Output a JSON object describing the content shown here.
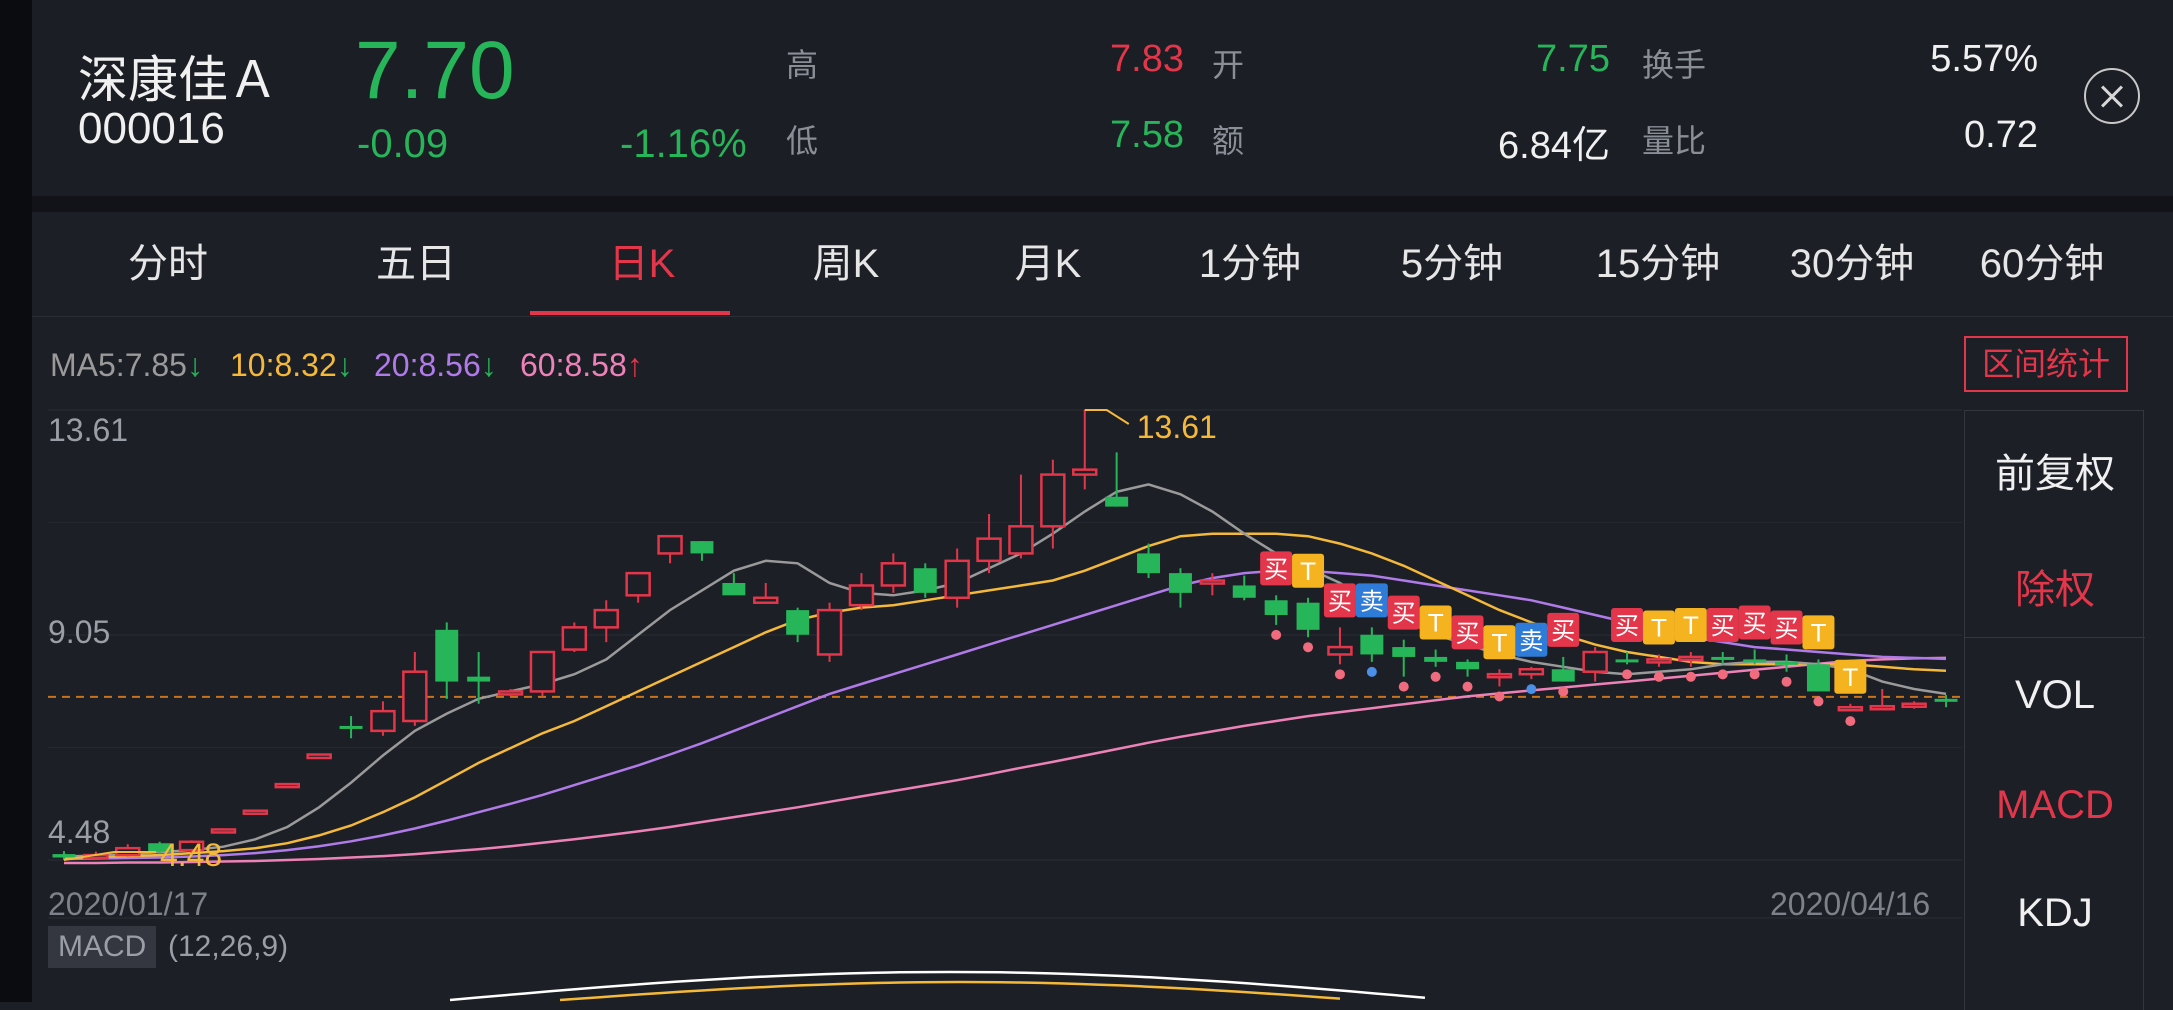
{
  "stock": {
    "name": "深康佳Ａ",
    "code": "000016",
    "price": "7.70",
    "change": "-0.09",
    "change_pct": "-1.16%"
  },
  "quote": {
    "high_label": "高",
    "high": "7.83",
    "open_label": "开",
    "open": "7.75",
    "turnover_label": "换手",
    "turnover": "5.57%",
    "low_label": "低",
    "low": "7.58",
    "amount_label": "额",
    "amount": "6.84亿",
    "vol_ratio_label": "量比",
    "vol_ratio": "0.72"
  },
  "tabs": [
    "分时",
    "五日",
    "日K",
    "周K",
    "月K",
    "1分钟",
    "5分钟",
    "15分钟",
    "30分钟",
    "60分钟"
  ],
  "active_tab": "日K",
  "ma": {
    "ma5": "MA5:7.85",
    "ma5_arrow": "↓",
    "ma10": "10:8.32",
    "ma10_arrow": "↓",
    "ma20": "20:8.56",
    "ma20_arrow": "↓",
    "ma60": "60:8.58",
    "ma60_arrow": "↑"
  },
  "range_stats_label": "区间统计",
  "side_panel": {
    "fq_before": "前复权",
    "fq_none": "除权",
    "vol": "VOL",
    "macd": "MACD",
    "kdj": "KDJ"
  },
  "macd_panel": {
    "tag": "MACD",
    "params": "(12,26,9)"
  },
  "colors": {
    "up": "#e3364a",
    "down": "#27b55a",
    "ma5": "#9a9a9a",
    "ma10": "#f5b93a",
    "ma20": "#b07be8",
    "ma60": "#ee82b8",
    "accent": "#e3364a"
  },
  "chart_data": {
    "type": "candlestick",
    "y_axis_labels": [
      "13.61",
      "9.05",
      "4.48"
    ],
    "ylim": [
      4.48,
      13.61
    ],
    "x_start": "2020/01/17",
    "x_end": "2020/04/16",
    "max_label": "13.61",
    "min_label": "4.48",
    "reference_price": 7.79,
    "candles": [
      {
        "o": 4.6,
        "h": 4.66,
        "l": 4.48,
        "c": 4.53
      },
      {
        "o": 4.55,
        "h": 4.65,
        "l": 4.5,
        "c": 4.58
      },
      {
        "o": 4.58,
        "h": 4.8,
        "l": 4.55,
        "c": 4.72
      },
      {
        "o": 4.82,
        "h": 4.85,
        "l": 4.6,
        "c": 4.65
      },
      {
        "o": 4.68,
        "h": 4.88,
        "l": 4.62,
        "c": 4.85
      },
      {
        "o": 5.05,
        "h": 5.12,
        "l": 5.02,
        "c": 5.1
      },
      {
        "o": 5.42,
        "h": 5.5,
        "l": 5.4,
        "c": 5.48
      },
      {
        "o": 5.96,
        "h": 6.03,
        "l": 5.94,
        "c": 6.02
      },
      {
        "o": 6.55,
        "h": 6.63,
        "l": 6.53,
        "c": 6.62
      },
      {
        "o": 7.2,
        "h": 7.4,
        "l": 6.95,
        "c": 7.15
      },
      {
        "o": 7.1,
        "h": 7.7,
        "l": 7.0,
        "c": 7.5
      },
      {
        "o": 7.3,
        "h": 8.7,
        "l": 7.2,
        "c": 8.3
      },
      {
        "o": 9.15,
        "h": 9.3,
        "l": 7.75,
        "c": 8.1
      },
      {
        "o": 8.2,
        "h": 8.7,
        "l": 7.65,
        "c": 8.1
      },
      {
        "o": 7.85,
        "h": 7.95,
        "l": 7.8,
        "c": 7.9
      },
      {
        "o": 7.9,
        "h": 8.7,
        "l": 7.8,
        "c": 8.7
      },
      {
        "o": 8.75,
        "h": 9.3,
        "l": 8.7,
        "c": 9.2
      },
      {
        "o": 9.2,
        "h": 9.75,
        "l": 8.9,
        "c": 9.55
      },
      {
        "o": 9.85,
        "h": 10.3,
        "l": 9.7,
        "c": 10.3
      },
      {
        "o": 10.7,
        "h": 11.05,
        "l": 10.5,
        "c": 11.05
      },
      {
        "o": 10.95,
        "h": 10.95,
        "l": 10.55,
        "c": 10.7
      },
      {
        "o": 10.1,
        "h": 10.3,
        "l": 9.9,
        "c": 9.85
      },
      {
        "o": 9.7,
        "h": 10.1,
        "l": 9.7,
        "c": 9.8
      },
      {
        "o": 9.55,
        "h": 9.6,
        "l": 8.9,
        "c": 9.05
      },
      {
        "o": 8.65,
        "h": 9.7,
        "l": 8.5,
        "c": 9.55
      },
      {
        "o": 9.65,
        "h": 10.3,
        "l": 9.55,
        "c": 10.05
      },
      {
        "o": 10.05,
        "h": 10.7,
        "l": 9.9,
        "c": 10.5
      },
      {
        "o": 10.4,
        "h": 10.5,
        "l": 9.8,
        "c": 9.9
      },
      {
        "o": 9.8,
        "h": 10.8,
        "l": 9.6,
        "c": 10.55
      },
      {
        "o": 10.55,
        "h": 11.5,
        "l": 10.3,
        "c": 11.0
      },
      {
        "o": 10.7,
        "h": 12.3,
        "l": 10.6,
        "c": 11.25
      },
      {
        "o": 11.25,
        "h": 12.6,
        "l": 10.8,
        "c": 12.3
      },
      {
        "o": 12.3,
        "h": 13.61,
        "l": 12.0,
        "c": 12.4
      },
      {
        "o": 11.85,
        "h": 12.75,
        "l": 11.65,
        "c": 11.65
      },
      {
        "o": 10.7,
        "h": 10.9,
        "l": 10.2,
        "c": 10.3
      },
      {
        "o": 10.3,
        "h": 10.4,
        "l": 9.6,
        "c": 9.9
      },
      {
        "o": 10.1,
        "h": 10.3,
        "l": 9.85,
        "c": 10.15
      },
      {
        "o": 10.05,
        "h": 10.25,
        "l": 9.75,
        "c": 9.8
      },
      {
        "o": 9.75,
        "h": 9.85,
        "l": 9.25,
        "c": 9.45
      },
      {
        "o": 9.7,
        "h": 9.8,
        "l": 9.0,
        "c": 9.15
      },
      {
        "o": 8.65,
        "h": 9.2,
        "l": 8.45,
        "c": 8.8
      },
      {
        "o": 9.05,
        "h": 9.2,
        "l": 8.5,
        "c": 8.65
      },
      {
        "o": 8.8,
        "h": 8.95,
        "l": 8.2,
        "c": 8.6
      },
      {
        "o": 8.6,
        "h": 8.75,
        "l": 8.4,
        "c": 8.5
      },
      {
        "o": 8.5,
        "h": 8.55,
        "l": 8.2,
        "c": 8.35
      },
      {
        "o": 8.25,
        "h": 8.35,
        "l": 8.0,
        "c": 8.25
      },
      {
        "o": 8.25,
        "h": 8.4,
        "l": 8.15,
        "c": 8.35
      },
      {
        "o": 8.35,
        "h": 8.6,
        "l": 8.1,
        "c": 8.1
      },
      {
        "o": 8.3,
        "h": 8.8,
        "l": 8.1,
        "c": 8.7
      },
      {
        "o": 8.55,
        "h": 8.7,
        "l": 8.45,
        "c": 8.5
      },
      {
        "o": 8.55,
        "h": 8.65,
        "l": 8.4,
        "c": 8.55
      },
      {
        "o": 8.55,
        "h": 8.7,
        "l": 8.4,
        "c": 8.6
      },
      {
        "o": 8.6,
        "h": 8.7,
        "l": 8.45,
        "c": 8.55
      },
      {
        "o": 8.55,
        "h": 8.75,
        "l": 8.45,
        "c": 8.5
      },
      {
        "o": 8.5,
        "h": 8.65,
        "l": 8.3,
        "c": 8.45
      },
      {
        "o": 8.45,
        "h": 8.55,
        "l": 7.9,
        "c": 7.9
      },
      {
        "o": 7.55,
        "h": 7.65,
        "l": 7.5,
        "c": 7.58
      },
      {
        "o": 7.6,
        "h": 7.95,
        "l": 7.55,
        "c": 7.6
      },
      {
        "o": 7.6,
        "h": 7.7,
        "l": 7.55,
        "c": 7.65
      },
      {
        "o": 7.75,
        "h": 7.83,
        "l": 7.58,
        "c": 7.7
      }
    ],
    "ma5": [
      4.55,
      4.57,
      4.6,
      4.64,
      4.68,
      4.75,
      4.9,
      5.15,
      5.55,
      6.05,
      6.6,
      7.1,
      7.45,
      7.75,
      7.9,
      8.05,
      8.25,
      8.55,
      9.05,
      9.55,
      9.95,
      10.35,
      10.55,
      10.5,
      10.1,
      9.9,
      9.85,
      9.95,
      10.1,
      10.4,
      10.7,
      11.1,
      11.55,
      11.95,
      12.1,
      11.9,
      11.55,
      11.1,
      10.7,
      10.4,
      10.1,
      9.7,
      9.35,
      9.05,
      8.85,
      8.65,
      8.5,
      8.4,
      8.3,
      8.25,
      8.3,
      8.35,
      8.45,
      8.5,
      8.5,
      8.45,
      8.35,
      8.1,
      7.95,
      7.85
    ],
    "ma10": [
      4.52,
      4.54,
      4.56,
      4.58,
      4.62,
      4.66,
      4.72,
      4.82,
      4.98,
      5.18,
      5.45,
      5.75,
      6.1,
      6.45,
      6.75,
      7.05,
      7.3,
      7.6,
      7.9,
      8.2,
      8.5,
      8.8,
      9.1,
      9.35,
      9.5,
      9.6,
      9.65,
      9.75,
      9.85,
      9.95,
      10.05,
      10.15,
      10.35,
      10.6,
      10.85,
      11.05,
      11.1,
      11.1,
      11.1,
      11.05,
      10.9,
      10.7,
      10.45,
      10.15,
      9.85,
      9.55,
      9.3,
      9.05,
      8.85,
      8.7,
      8.6,
      8.5,
      8.45,
      8.45,
      8.45,
      8.45,
      8.45,
      8.4,
      8.35,
      8.32
    ],
    "ma20": [
      4.5,
      4.51,
      4.52,
      4.53,
      4.55,
      4.58,
      4.62,
      4.68,
      4.76,
      4.86,
      4.98,
      5.12,
      5.28,
      5.45,
      5.62,
      5.8,
      6.0,
      6.2,
      6.4,
      6.62,
      6.85,
      7.1,
      7.35,
      7.6,
      7.85,
      8.05,
      8.25,
      8.45,
      8.65,
      8.85,
      9.05,
      9.25,
      9.45,
      9.65,
      9.85,
      10.05,
      10.2,
      10.3,
      10.35,
      10.35,
      10.3,
      10.25,
      10.15,
      10.05,
      9.95,
      9.85,
      9.75,
      9.6,
      9.45,
      9.3,
      9.15,
      9.0,
      8.9,
      8.8,
      8.75,
      8.7,
      8.65,
      8.6,
      8.58,
      8.56
    ],
    "ma60": [
      4.42,
      4.42,
      4.43,
      4.43,
      4.44,
      4.45,
      4.46,
      4.48,
      4.5,
      4.53,
      4.56,
      4.6,
      4.65,
      4.7,
      4.76,
      4.83,
      4.9,
      4.98,
      5.06,
      5.15,
      5.25,
      5.35,
      5.45,
      5.55,
      5.66,
      5.77,
      5.88,
      5.99,
      6.1,
      6.22,
      6.35,
      6.47,
      6.6,
      6.73,
      6.86,
      6.98,
      7.09,
      7.2,
      7.3,
      7.4,
      7.48,
      7.56,
      7.64,
      7.72,
      7.8,
      7.86,
      7.92,
      7.98,
      8.04,
      8.1,
      8.16,
      8.22,
      8.28,
      8.34,
      8.4,
      8.46,
      8.52,
      8.55,
      8.57,
      8.58
    ],
    "signals": [
      {
        "i": 38,
        "label": "买",
        "kind": "buy",
        "side": "above"
      },
      {
        "i": 39,
        "label": "T",
        "kind": "t",
        "side": "above"
      },
      {
        "i": 40,
        "label": "买",
        "kind": "buy",
        "side": "above"
      },
      {
        "i": 41,
        "label": "卖",
        "kind": "sell",
        "side": "above"
      },
      {
        "i": 42,
        "label": "买",
        "kind": "buy",
        "side": "above"
      },
      {
        "i": 43,
        "label": "T",
        "kind": "t",
        "side": "above"
      },
      {
        "i": 44,
        "label": "买",
        "kind": "buy",
        "side": "above"
      },
      {
        "i": 45,
        "label": "T",
        "kind": "t",
        "side": "above"
      },
      {
        "i": 46,
        "label": "卖",
        "kind": "sell",
        "side": "above"
      },
      {
        "i": 47,
        "label": "买",
        "kind": "buy",
        "side": "above"
      },
      {
        "i": 49,
        "label": "买",
        "kind": "buy",
        "side": "above"
      },
      {
        "i": 50,
        "label": "T",
        "kind": "t",
        "side": "above"
      },
      {
        "i": 51,
        "label": "T",
        "kind": "t",
        "side": "above"
      },
      {
        "i": 52,
        "label": "买",
        "kind": "buy",
        "side": "above"
      },
      {
        "i": 53,
        "label": "买",
        "kind": "buy",
        "side": "above"
      },
      {
        "i": 54,
        "label": "买",
        "kind": "buy",
        "side": "above"
      },
      {
        "i": 55,
        "label": "T",
        "kind": "t",
        "side": "above"
      },
      {
        "i": 56,
        "label": "T",
        "kind": "t",
        "side": "above"
      }
    ]
  }
}
